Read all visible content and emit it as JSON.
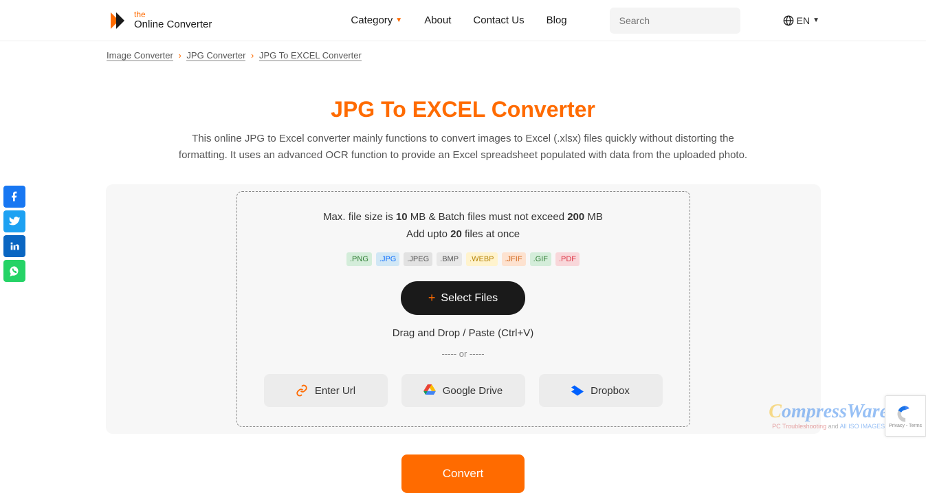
{
  "header": {
    "logo": {
      "line1": "the",
      "line2": "Online Converter"
    },
    "nav": {
      "category": "Category",
      "about": "About",
      "contact": "Contact Us",
      "blog": "Blog"
    },
    "search_placeholder": "Search",
    "lang": "EN"
  },
  "breadcrumb": {
    "items": [
      "Image Converter",
      "JPG Converter",
      "JPG To EXCEL Converter"
    ]
  },
  "main": {
    "title": "JPG To EXCEL Converter",
    "desc": "This online JPG to Excel converter mainly functions to convert images to Excel (.xlsx) files quickly without distorting the formatting. It uses an advanced OCR function to provide an Excel spreadsheet populated with data from the uploaded photo."
  },
  "upload": {
    "limits_pre": "Max. file size is ",
    "limits_size": "10",
    "limits_mid": " MB & Batch files must not exceed ",
    "limits_batch": "200",
    "limits_post": " MB",
    "addupto_pre": "Add upto ",
    "addupto_n": "20",
    "addupto_post": " files at once",
    "formats": [
      {
        "label": ".PNG",
        "bg": "#d4edda",
        "color": "#2e7d32"
      },
      {
        "label": ".JPG",
        "bg": "#d1e7f5",
        "color": "#0d6efd"
      },
      {
        "label": ".JPEG",
        "bg": "#e2e2e2",
        "color": "#555"
      },
      {
        "label": ".BMP",
        "bg": "#e8e8e8",
        "color": "#555"
      },
      {
        "label": ".WEBP",
        "bg": "#fff3cd",
        "color": "#b8860b"
      },
      {
        "label": ".JFIF",
        "bg": "#fde2d0",
        "color": "#d2691e"
      },
      {
        "label": ".GIF",
        "bg": "#d4edda",
        "color": "#2e7d32"
      },
      {
        "label": ".PDF",
        "bg": "#f8d7da",
        "color": "#dc3545"
      }
    ],
    "select_files": "Select Files",
    "dragdrop": "Drag and Drop / Paste (Ctrl+V)",
    "or": "----- or -----",
    "sources": {
      "url": "Enter Url",
      "drive": "Google Drive",
      "dropbox": "Dropbox"
    }
  },
  "convert": "Convert",
  "watermark": {
    "name_rest": "ompressWare",
    "tagline_a": "PC Troubleshooting",
    "tagline_mid": " and ",
    "tagline_b": "All ISO IMAGES"
  },
  "recaptcha": "Privacy - Terms"
}
